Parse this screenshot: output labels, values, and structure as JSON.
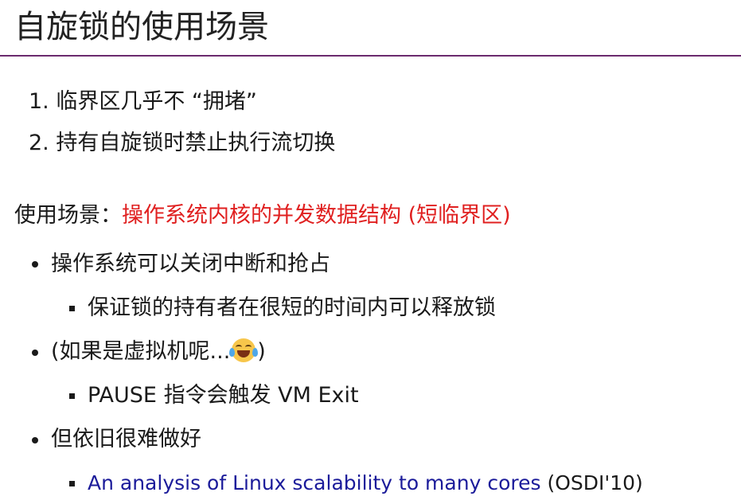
{
  "title": "自旋锁的使用场景",
  "numbered": [
    "1. 临界区几乎不 “拥堵”",
    "2. 持有自旋锁时禁止执行流切换"
  ],
  "usage": {
    "label": "使用场景：",
    "highlight": "操作系统内核的并发数据结构 (短临界区)"
  },
  "bullets": [
    {
      "text": "操作系统可以关闭中断和抢占",
      "sub": "保证锁的持有者在很短的时间内可以释放锁"
    },
    {
      "text_before": "(如果是虚拟机呢...",
      "text_after": ")",
      "icon": "laughing-tears-emoji",
      "sub": "PAUSE 指令会触发 VM Exit"
    },
    {
      "text": "但依旧很难做好",
      "sub_link": "An analysis of Linux scalability to many cores",
      "sub_after": " (OSDI'10)"
    }
  ],
  "colors": {
    "accent_red": "#e02020",
    "link_blue": "#1b1b9a",
    "title_rule": "#6b2a6e"
  }
}
